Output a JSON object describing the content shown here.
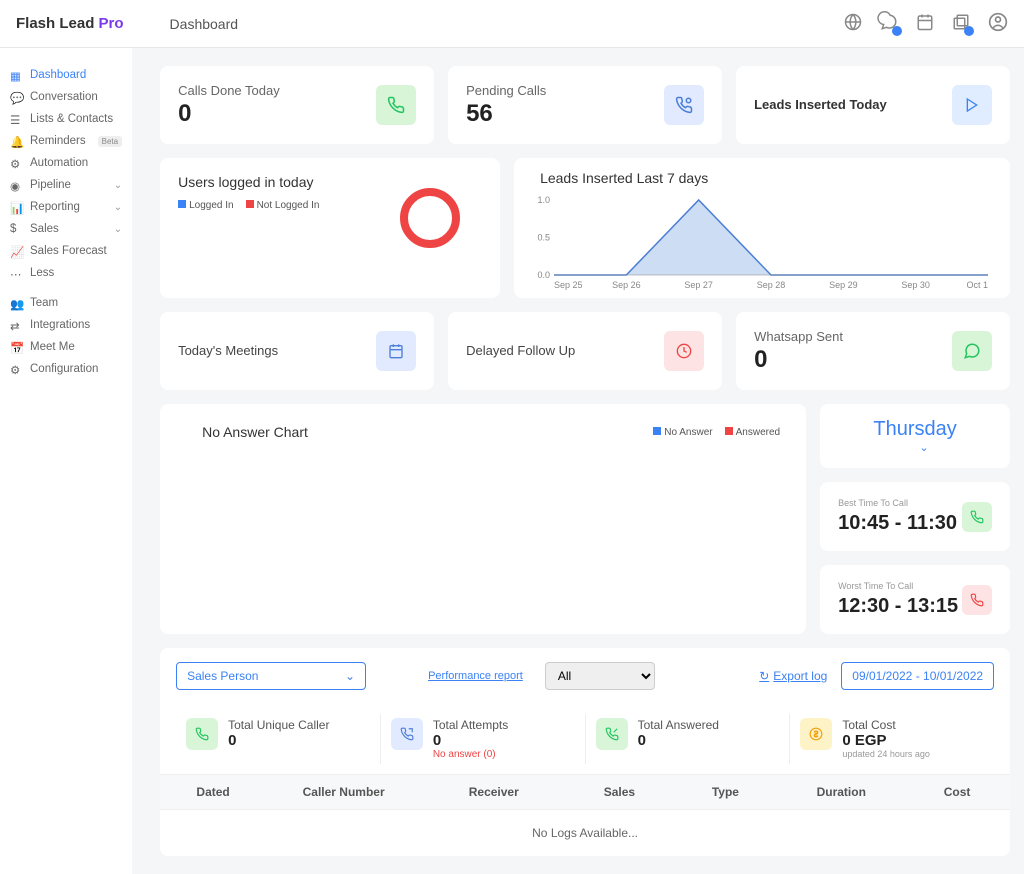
{
  "brand": {
    "name": "Flash Lead",
    "suffix": "Pro"
  },
  "page_title": "Dashboard",
  "sidebar": {
    "items": [
      {
        "label": "Dashboard",
        "icon": "grid",
        "active": true
      },
      {
        "label": "Conversation",
        "icon": "chat"
      },
      {
        "label": "Lists & Contacts",
        "icon": "list"
      },
      {
        "label": "Reminders",
        "icon": "bell",
        "beta": "Beta"
      },
      {
        "label": "Automation",
        "icon": "auto"
      },
      {
        "label": "Pipeline",
        "icon": "pipe",
        "expandable": true
      },
      {
        "label": "Reporting",
        "icon": "report",
        "expandable": true
      },
      {
        "label": "Sales",
        "icon": "dollar",
        "expandable": true
      },
      {
        "label": "Sales Forecast",
        "icon": "forecast"
      },
      {
        "label": "Less",
        "icon": "dots"
      },
      {
        "label": "Team",
        "icon": "team"
      },
      {
        "label": "Integrations",
        "icon": "integ"
      },
      {
        "label": "Meet Me",
        "icon": "meet"
      },
      {
        "label": "Configuration",
        "icon": "config"
      }
    ]
  },
  "stats": {
    "calls_done": {
      "label": "Calls Done Today",
      "value": "0"
    },
    "pending_calls": {
      "label": "Pending Calls",
      "value": "56"
    },
    "leads_inserted": {
      "label": "Leads Inserted Today"
    },
    "whatsapp_sent": {
      "label": "Whatsapp Sent",
      "value": "0"
    },
    "todays_meetings": {
      "label": "Today's Meetings"
    },
    "delayed_followup": {
      "label": "Delayed Follow Up"
    }
  },
  "users_logged": {
    "title": "Users logged in today",
    "legend": {
      "a": "Logged In",
      "b": "Not Logged In"
    }
  },
  "leads_chart_title": "Leads Inserted Last 7 days",
  "chart_data": {
    "type": "area",
    "title": "Leads Inserted Last 7 days",
    "xlabel": "",
    "ylabel": "",
    "ylim": [
      0,
      1.0
    ],
    "yticks": [
      0.0,
      0.5,
      1.0
    ],
    "categories": [
      "Sep 25",
      "Sep 26",
      "Sep 27",
      "Sep 28",
      "Sep 29",
      "Sep 30",
      "Oct 1"
    ],
    "values": [
      0,
      0,
      1,
      0,
      0,
      0,
      0
    ]
  },
  "no_answer": {
    "title": "No Answer Chart",
    "legend": {
      "a": "No Answer",
      "b": "Answered"
    }
  },
  "day_selector": "Thursday",
  "best_time": {
    "label": "Best Time To Call",
    "range": "10:45 - 11:30"
  },
  "worst_time": {
    "label": "Worst Time To Call",
    "range": "12:30 - 13:15"
  },
  "filters": {
    "sales_person": "Sales Person",
    "performance_report": "Performance report",
    "all": "All",
    "export_log": "Export log",
    "date_range": "09/01/2022 - 10/01/2022"
  },
  "totals": {
    "unique_caller": {
      "label": "Total Unique Caller",
      "value": "0"
    },
    "attempts": {
      "label": "Total Attempts",
      "value": "0",
      "sub": "No answer (0)"
    },
    "answered": {
      "label": "Total Answered",
      "value": "0"
    },
    "cost": {
      "label": "Total Cost",
      "value": "0 EGP",
      "sub": "updated 24 hours ago"
    }
  },
  "table": {
    "headers": [
      "Dated",
      "Caller Number",
      "Receiver",
      "Sales",
      "Type",
      "Duration",
      "Cost"
    ],
    "empty": "No Logs Available..."
  }
}
